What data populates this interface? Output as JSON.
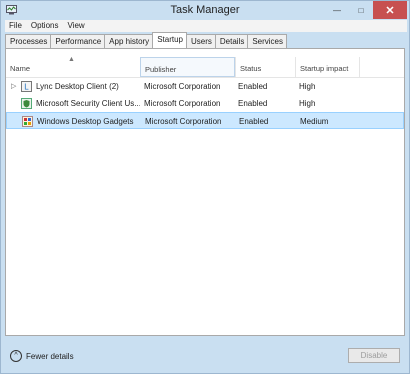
{
  "window": {
    "title": "Task Manager"
  },
  "controls": {
    "minimize": "—",
    "maximize": "□",
    "close": "✕"
  },
  "menu": [
    "File",
    "Options",
    "View"
  ],
  "tabs": [
    "Processes",
    "Performance",
    "App history",
    "Startup",
    "Users",
    "Details",
    "Services"
  ],
  "active_tab": "Startup",
  "columns": [
    "Name",
    "Publisher",
    "Status",
    "Startup impact"
  ],
  "rows": [
    {
      "name": "Lync Desktop Client (2)",
      "publisher": "Microsoft Corporation",
      "status": "Enabled",
      "impact": "High",
      "expandable": true,
      "icon": "lync-icon"
    },
    {
      "name": "Microsoft Security Client Us...",
      "publisher": "Microsoft Corporation",
      "status": "Enabled",
      "impact": "High",
      "expandable": false,
      "icon": "shield-icon"
    },
    {
      "name": "Windows Desktop Gadgets",
      "publisher": "Microsoft Corporation",
      "status": "Enabled",
      "impact": "Medium",
      "expandable": false,
      "icon": "gadgets-icon",
      "selected": true
    }
  ],
  "footer": {
    "fewer_details": "Fewer details",
    "disable": "Disable"
  },
  "colors": {
    "frame": "#c9dff1",
    "selection": "#cce8ff",
    "close": "#c75050"
  }
}
